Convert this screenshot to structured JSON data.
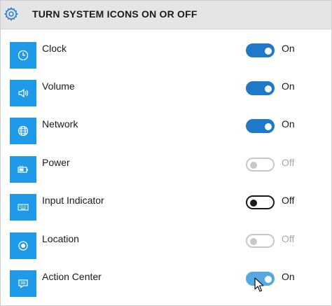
{
  "header": {
    "title": "TURN SYSTEM ICONS ON OR OFF",
    "icon": "gear-icon"
  },
  "rows": [
    {
      "label": "Clock",
      "state": "On",
      "icon": "clock-icon",
      "toggle": "on"
    },
    {
      "label": "Volume",
      "state": "On",
      "icon": "speaker-icon",
      "toggle": "on"
    },
    {
      "label": "Network",
      "state": "On",
      "icon": "globe-icon",
      "toggle": "on"
    },
    {
      "label": "Power",
      "state": "Off",
      "icon": "battery-icon",
      "toggle": "disabled"
    },
    {
      "label": "Input Indicator",
      "state": "Off",
      "icon": "keyboard-icon",
      "toggle": "off"
    },
    {
      "label": "Location",
      "state": "Off",
      "icon": "location-icon",
      "toggle": "disabled"
    },
    {
      "label": "Action Center",
      "state": "On",
      "icon": "action-center-icon",
      "toggle": "hover-on"
    }
  ],
  "colors": {
    "accent": "#1e9ae8",
    "toggle_on": "#1e7ac9",
    "header_bg": "#e5e5e5"
  }
}
